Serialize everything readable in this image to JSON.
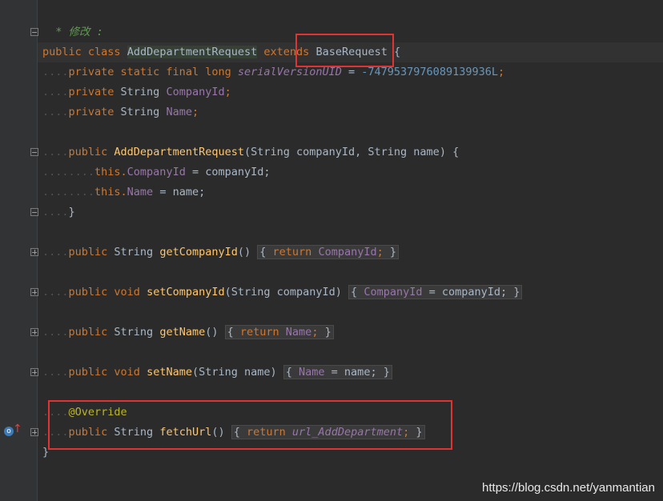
{
  "editor": {
    "comment_line_1": "* 修改 :",
    "comment_line_2": "*/",
    "class_decl": {
      "kw_public": "public",
      "kw_class": "class",
      "name": "AddDepartmentRequest",
      "kw_extends": "extends",
      "base": "BaseRequest",
      "brace": "{"
    },
    "fields": [
      {
        "text_mods": "private static final long ",
        "name": "serialVersionUID",
        "eq": " = ",
        "value": "-7479537976089139936L",
        "semi": ";"
      },
      {
        "text_mods": "private ",
        "type": "String ",
        "name": "CompanyId",
        "semi": ";"
      },
      {
        "text_mods": "private ",
        "type": "String ",
        "name": "Name",
        "semi": ";"
      }
    ],
    "constructor": {
      "kw": "public ",
      "name": "AddDepartmentRequest",
      "params": "(String companyId, String name) {",
      "body_1_this": "this.",
      "body_1_field": "CompanyId",
      "body_1_rest": " = companyId;",
      "body_2_this": "this.",
      "body_2_field": "Name",
      "body_2_rest": " = name;",
      "close": "}"
    },
    "methods": [
      {
        "mods": "public ",
        "type": "String ",
        "name": "getCompanyId",
        "sig": "() ",
        "body_kw": "return ",
        "body_field": "CompanyId",
        "body_rest": ";",
        "open": "{ ",
        "close": " }"
      },
      {
        "mods": "public void ",
        "type": "",
        "name": "setCompanyId",
        "sig": "(String companyId) ",
        "body_kw": "",
        "body_field": "CompanyId",
        "body_rest": " = companyId;",
        "open": "{ ",
        "close": " }"
      },
      {
        "mods": "public ",
        "type": "String ",
        "name": "getName",
        "sig": "() ",
        "body_kw": "return ",
        "body_field": "Name",
        "body_rest": ";",
        "open": "{ ",
        "close": " }"
      },
      {
        "mods": "public void ",
        "type": "",
        "name": "setName",
        "sig": "(String name) ",
        "body_kw": "",
        "body_field": "Name",
        "body_rest": " = name;",
        "open": "{ ",
        "close": " }"
      }
    ],
    "override_annotation": "@Override",
    "fetch_method": {
      "mods": "public ",
      "type": "String ",
      "name": "fetchUrl",
      "sig": "() ",
      "open": "{ ",
      "body_kw": "return ",
      "body_field": "url_AddDepartment",
      "body_rest": ";",
      "close": " }"
    },
    "class_close": "}",
    "dots_4": "....",
    "dots_8": "........"
  },
  "watermark": "https://blog.csdn.net/yanmantian",
  "colors": {
    "highlight_box": "#e03333",
    "background": "#2b2b2b"
  }
}
